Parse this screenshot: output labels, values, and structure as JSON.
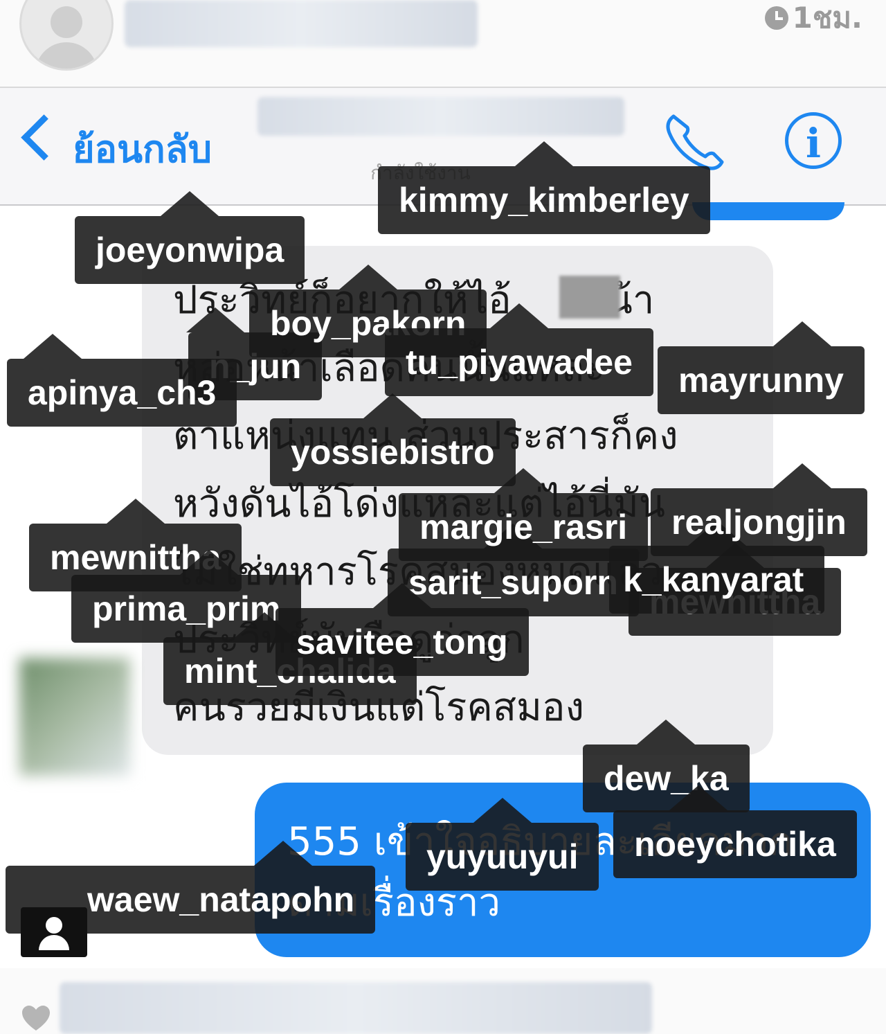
{
  "post": {
    "time": "1ชม.",
    "clock_icon": "clock-icon"
  },
  "messenger": {
    "back_label": "ย้อนกลับ",
    "status": "กำลังใช้งาน",
    "accent": "#1e87f0"
  },
  "received_message": [
    "ประวิทย์ก็อยากให้ไอ้",
    "หน้า",
    "หล่อหน้าเลือดคนนั้นแหละ",
    "ตาแหน่งแทน ส่วนประสารก็คง",
    "หวังดันไอ้โด่งแหละแต่ไอ้นี่มัน",
    "ไม่ใช่ทหารโรคสมองหมดแล้ว",
    "ประวิทย์มันลือดูว่าลูก",
    "คนรวยมีเงินแต่โรคสมอง"
  ],
  "sent_message": [
    "555 เข้าใจอธิบายละเอียดมาก",
    "ตามเรื่องราว"
  ],
  "tags": [
    "kimmy_kimberley",
    "joeyonwipa",
    "boy_pakorn",
    "n_jun",
    "tu_piyawadee",
    "apinya_ch3",
    "mayrunny",
    "yossiebistro",
    "margie_rasri",
    "realjongjin",
    "mewnittha",
    "sarit_suporn",
    "k_kanyarat",
    "prima_prim",
    "savitee_tong",
    "mint_chalida",
    "dew_ka",
    "yuyuuyui",
    "noeychotika",
    "waew_natapohn"
  ]
}
